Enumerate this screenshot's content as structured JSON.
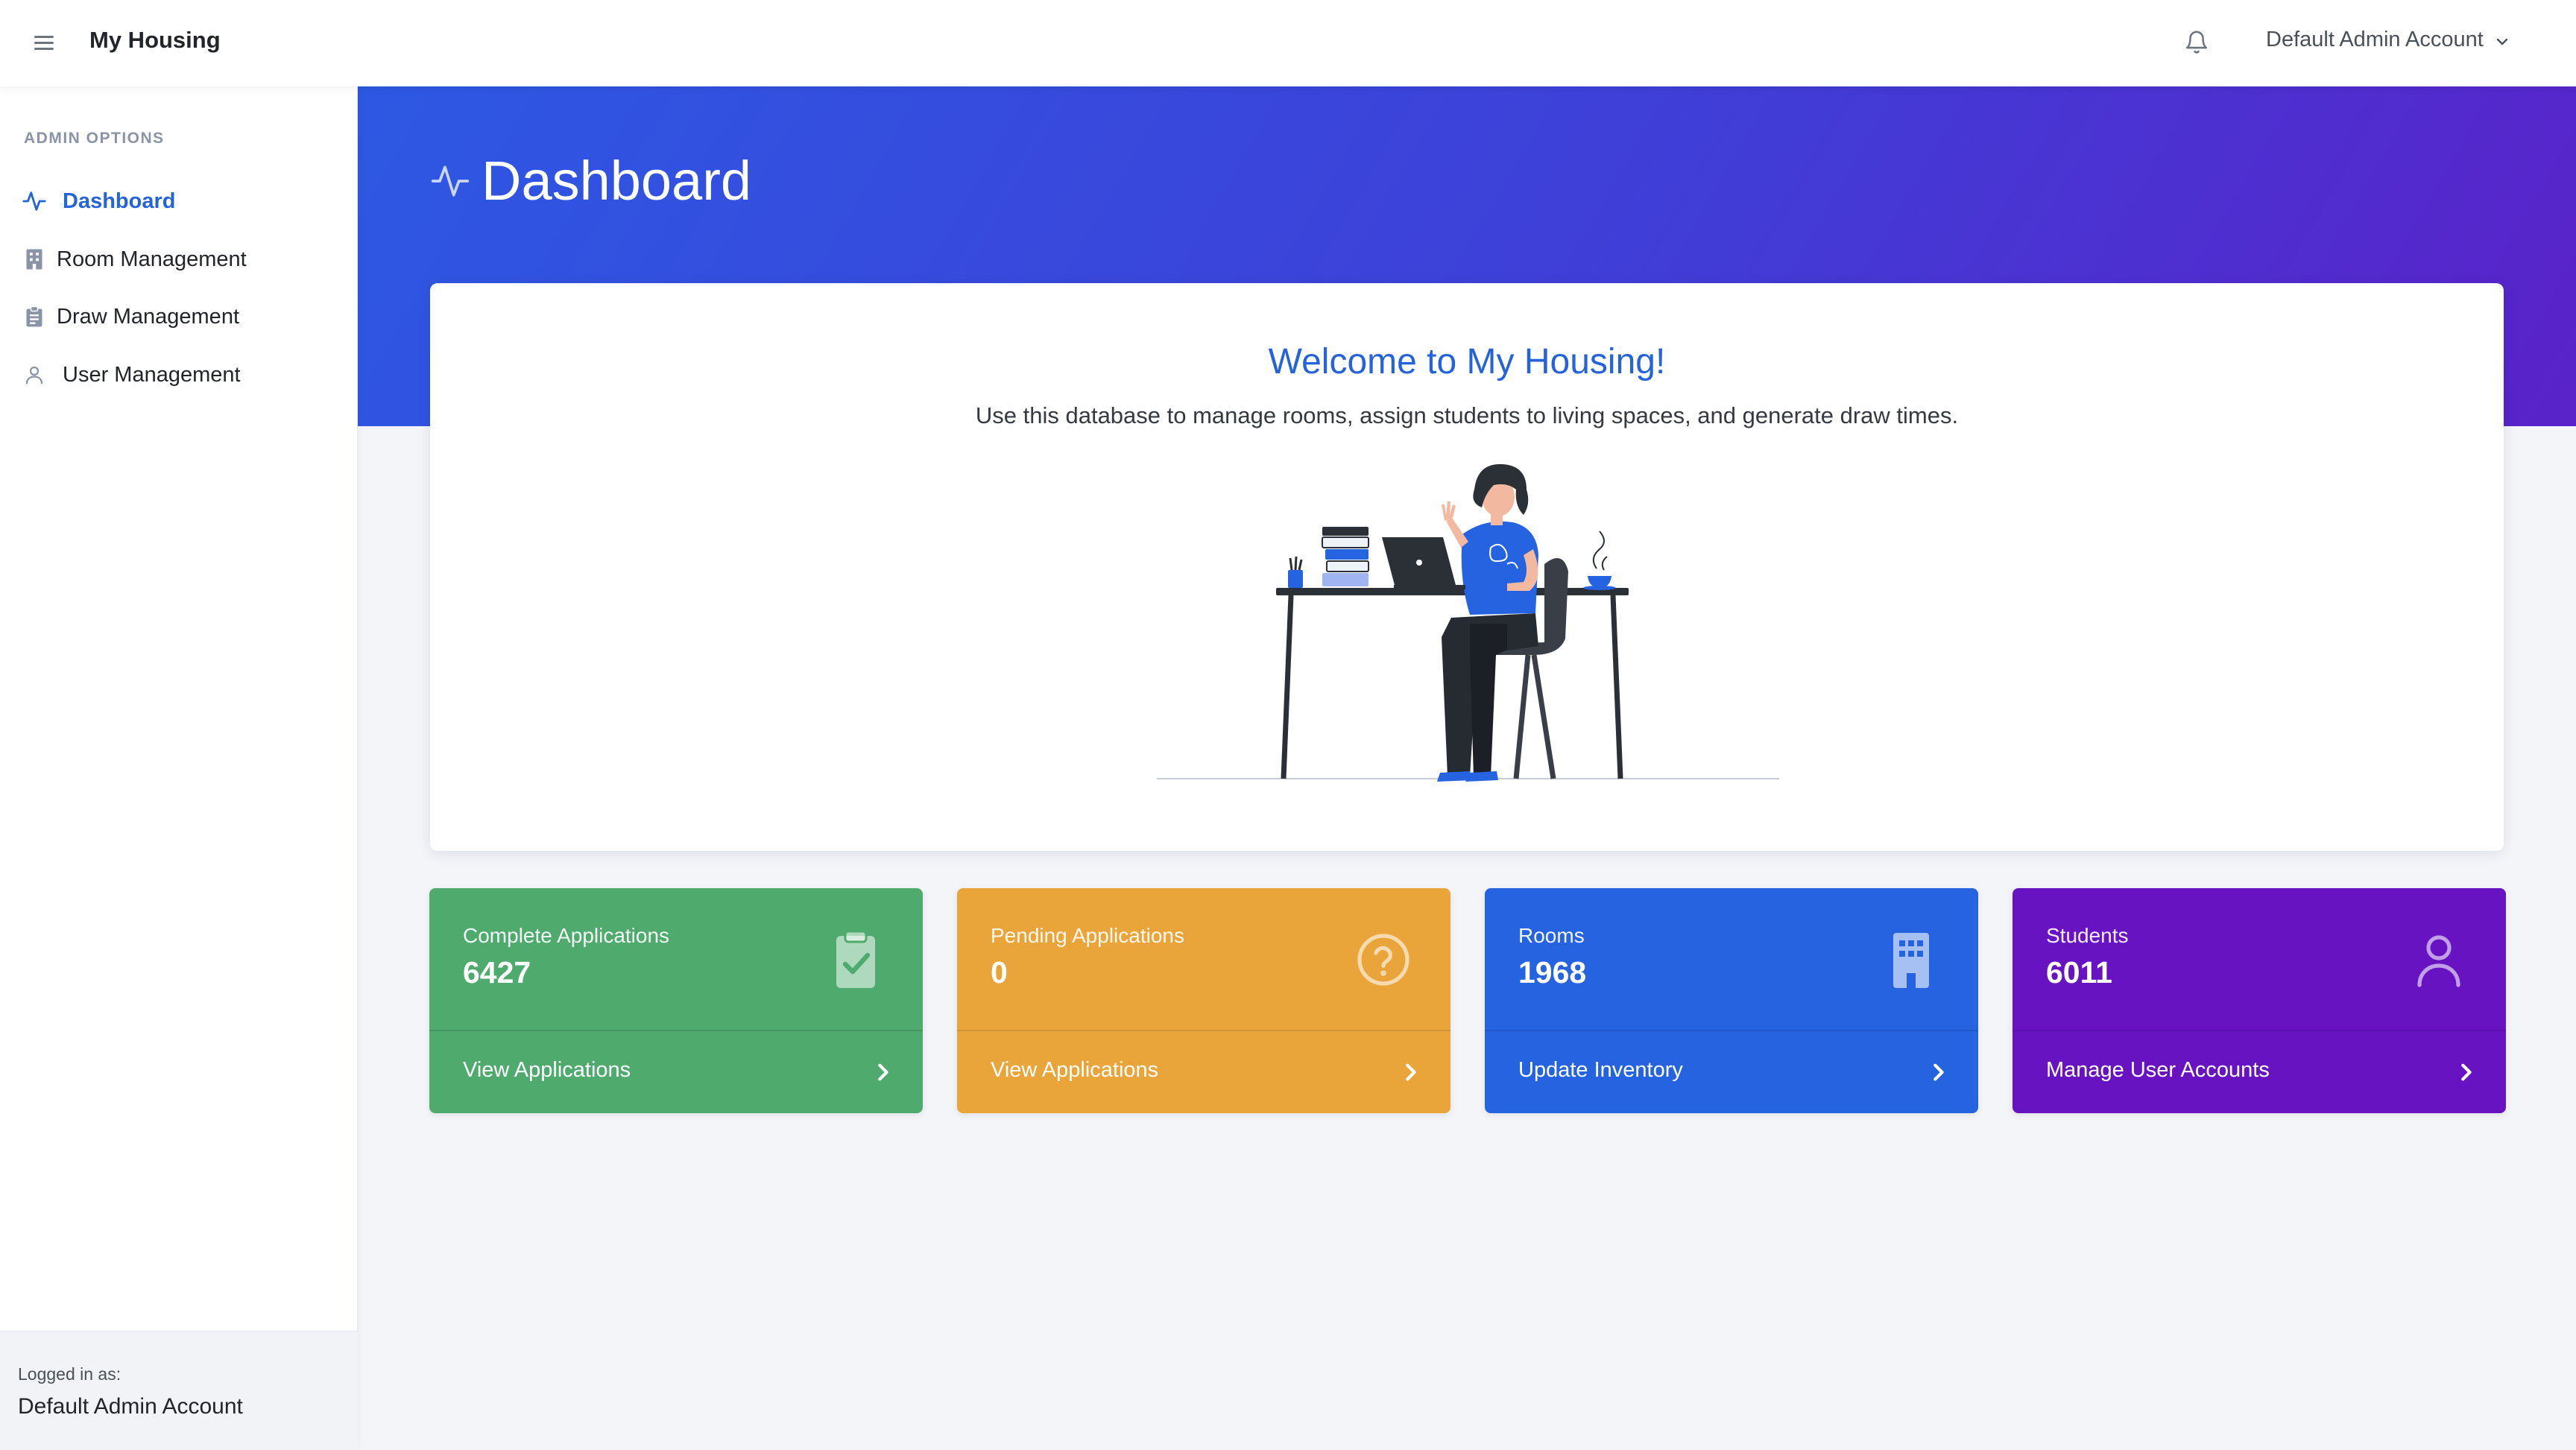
{
  "topbar": {
    "brand": "My Housing",
    "account_name": "Default Admin Account",
    "menu_icon": "hamburger-menu-icon",
    "notification_icon": "bell-icon"
  },
  "sidebar": {
    "heading": "ADMIN OPTIONS",
    "items": [
      {
        "label": "Dashboard",
        "icon": "activity-icon",
        "active": true
      },
      {
        "label": "Room Management",
        "icon": "building-icon",
        "active": false
      },
      {
        "label": "Draw Management",
        "icon": "clipboard-icon",
        "active": false
      },
      {
        "label": "User Management",
        "icon": "user-icon",
        "active": false
      }
    ],
    "footer": {
      "logged_in_label": "Logged in as:",
      "logged_in_name": "Default Admin Account"
    }
  },
  "page": {
    "title": "Dashboard",
    "title_icon": "activity-icon"
  },
  "welcome": {
    "title": "Welcome to My Housing!",
    "subtitle": "Use this database to manage rooms, assign students to living spaces, and generate draw times."
  },
  "stats": [
    {
      "label": "Complete Applications",
      "value": "6427",
      "link": "View Applications",
      "icon": "clipboard-check-icon",
      "color": "#4faa6e"
    },
    {
      "label": "Pending Applications",
      "value": "0",
      "link": "View Applications",
      "icon": "question-circle-icon",
      "color": "#e9a43a"
    },
    {
      "label": "Rooms",
      "value": "1968",
      "link": "Update Inventory",
      "icon": "building-icon",
      "color": "#2563e0"
    },
    {
      "label": "Students",
      "value": "6011",
      "link": "Manage User Accounts",
      "icon": "user-icon",
      "color": "#6813c2"
    }
  ],
  "colors": {
    "accent": "#2563d9",
    "hero_gradient_start": "#2d58e3",
    "hero_gradient_end": "#5a22c9",
    "page_background": "#f3f5f9"
  }
}
